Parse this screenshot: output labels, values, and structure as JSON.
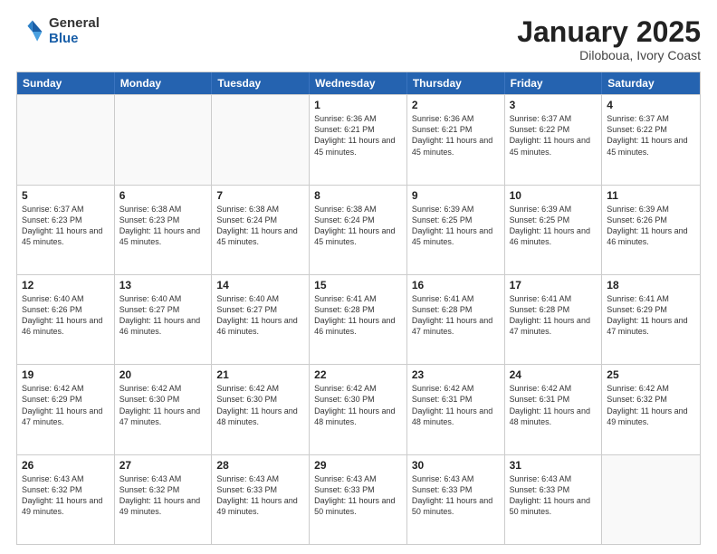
{
  "header": {
    "logo_general": "General",
    "logo_blue": "Blue",
    "title": "January 2025",
    "subtitle": "Diloboua, Ivory Coast"
  },
  "weekdays": [
    "Sunday",
    "Monday",
    "Tuesday",
    "Wednesday",
    "Thursday",
    "Friday",
    "Saturday"
  ],
  "rows": [
    [
      {
        "day": "",
        "info": ""
      },
      {
        "day": "",
        "info": ""
      },
      {
        "day": "",
        "info": ""
      },
      {
        "day": "1",
        "info": "Sunrise: 6:36 AM\nSunset: 6:21 PM\nDaylight: 11 hours\nand 45 minutes."
      },
      {
        "day": "2",
        "info": "Sunrise: 6:36 AM\nSunset: 6:21 PM\nDaylight: 11 hours\nand 45 minutes."
      },
      {
        "day": "3",
        "info": "Sunrise: 6:37 AM\nSunset: 6:22 PM\nDaylight: 11 hours\nand 45 minutes."
      },
      {
        "day": "4",
        "info": "Sunrise: 6:37 AM\nSunset: 6:22 PM\nDaylight: 11 hours\nand 45 minutes."
      }
    ],
    [
      {
        "day": "5",
        "info": "Sunrise: 6:37 AM\nSunset: 6:23 PM\nDaylight: 11 hours\nand 45 minutes."
      },
      {
        "day": "6",
        "info": "Sunrise: 6:38 AM\nSunset: 6:23 PM\nDaylight: 11 hours\nand 45 minutes."
      },
      {
        "day": "7",
        "info": "Sunrise: 6:38 AM\nSunset: 6:24 PM\nDaylight: 11 hours\nand 45 minutes."
      },
      {
        "day": "8",
        "info": "Sunrise: 6:38 AM\nSunset: 6:24 PM\nDaylight: 11 hours\nand 45 minutes."
      },
      {
        "day": "9",
        "info": "Sunrise: 6:39 AM\nSunset: 6:25 PM\nDaylight: 11 hours\nand 45 minutes."
      },
      {
        "day": "10",
        "info": "Sunrise: 6:39 AM\nSunset: 6:25 PM\nDaylight: 11 hours\nand 46 minutes."
      },
      {
        "day": "11",
        "info": "Sunrise: 6:39 AM\nSunset: 6:26 PM\nDaylight: 11 hours\nand 46 minutes."
      }
    ],
    [
      {
        "day": "12",
        "info": "Sunrise: 6:40 AM\nSunset: 6:26 PM\nDaylight: 11 hours\nand 46 minutes."
      },
      {
        "day": "13",
        "info": "Sunrise: 6:40 AM\nSunset: 6:27 PM\nDaylight: 11 hours\nand 46 minutes."
      },
      {
        "day": "14",
        "info": "Sunrise: 6:40 AM\nSunset: 6:27 PM\nDaylight: 11 hours\nand 46 minutes."
      },
      {
        "day": "15",
        "info": "Sunrise: 6:41 AM\nSunset: 6:28 PM\nDaylight: 11 hours\nand 46 minutes."
      },
      {
        "day": "16",
        "info": "Sunrise: 6:41 AM\nSunset: 6:28 PM\nDaylight: 11 hours\nand 47 minutes."
      },
      {
        "day": "17",
        "info": "Sunrise: 6:41 AM\nSunset: 6:28 PM\nDaylight: 11 hours\nand 47 minutes."
      },
      {
        "day": "18",
        "info": "Sunrise: 6:41 AM\nSunset: 6:29 PM\nDaylight: 11 hours\nand 47 minutes."
      }
    ],
    [
      {
        "day": "19",
        "info": "Sunrise: 6:42 AM\nSunset: 6:29 PM\nDaylight: 11 hours\nand 47 minutes."
      },
      {
        "day": "20",
        "info": "Sunrise: 6:42 AM\nSunset: 6:30 PM\nDaylight: 11 hours\nand 47 minutes."
      },
      {
        "day": "21",
        "info": "Sunrise: 6:42 AM\nSunset: 6:30 PM\nDaylight: 11 hours\nand 48 minutes."
      },
      {
        "day": "22",
        "info": "Sunrise: 6:42 AM\nSunset: 6:30 PM\nDaylight: 11 hours\nand 48 minutes."
      },
      {
        "day": "23",
        "info": "Sunrise: 6:42 AM\nSunset: 6:31 PM\nDaylight: 11 hours\nand 48 minutes."
      },
      {
        "day": "24",
        "info": "Sunrise: 6:42 AM\nSunset: 6:31 PM\nDaylight: 11 hours\nand 48 minutes."
      },
      {
        "day": "25",
        "info": "Sunrise: 6:42 AM\nSunset: 6:32 PM\nDaylight: 11 hours\nand 49 minutes."
      }
    ],
    [
      {
        "day": "26",
        "info": "Sunrise: 6:43 AM\nSunset: 6:32 PM\nDaylight: 11 hours\nand 49 minutes."
      },
      {
        "day": "27",
        "info": "Sunrise: 6:43 AM\nSunset: 6:32 PM\nDaylight: 11 hours\nand 49 minutes."
      },
      {
        "day": "28",
        "info": "Sunrise: 6:43 AM\nSunset: 6:33 PM\nDaylight: 11 hours\nand 49 minutes."
      },
      {
        "day": "29",
        "info": "Sunrise: 6:43 AM\nSunset: 6:33 PM\nDaylight: 11 hours\nand 50 minutes."
      },
      {
        "day": "30",
        "info": "Sunrise: 6:43 AM\nSunset: 6:33 PM\nDaylight: 11 hours\nand 50 minutes."
      },
      {
        "day": "31",
        "info": "Sunrise: 6:43 AM\nSunset: 6:33 PM\nDaylight: 11 hours\nand 50 minutes."
      },
      {
        "day": "",
        "info": ""
      }
    ]
  ]
}
